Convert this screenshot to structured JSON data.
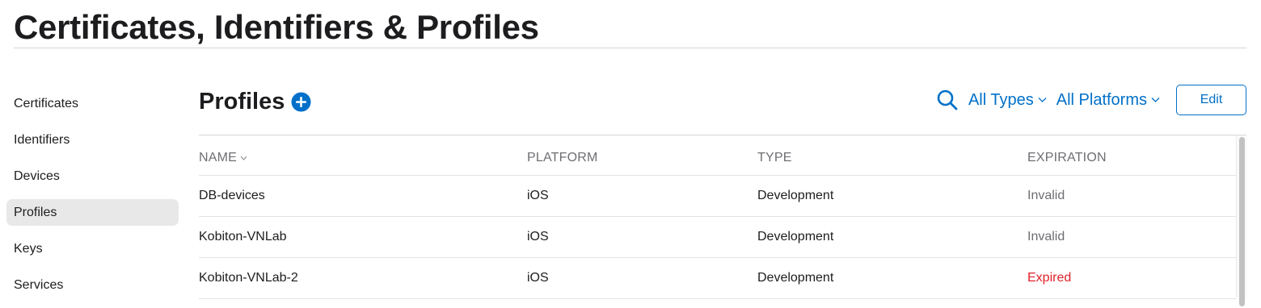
{
  "page_title": "Certificates, Identifiers & Profiles",
  "sidebar": {
    "items": [
      {
        "label": "Certificates"
      },
      {
        "label": "Identifiers"
      },
      {
        "label": "Devices"
      },
      {
        "label": "Profiles",
        "active": true
      },
      {
        "label": "Keys"
      },
      {
        "label": "Services"
      }
    ]
  },
  "section": {
    "title": "Profiles",
    "add_icon": "plus-circle-icon"
  },
  "toolbar": {
    "search_icon": "search-icon",
    "type_filter": "All Types",
    "platform_filter": "All Platforms",
    "edit_label": "Edit"
  },
  "table": {
    "headers": {
      "name": "NAME",
      "platform": "PLATFORM",
      "type": "TYPE",
      "expiration": "EXPIRATION"
    },
    "rows": [
      {
        "name": "DB-devices",
        "platform": "iOS",
        "type": "Development",
        "expiration": "Invalid"
      },
      {
        "name": "Kobiton-VNLab",
        "platform": "iOS",
        "type": "Development",
        "expiration": "Invalid"
      },
      {
        "name": "Kobiton-VNLab-2",
        "platform": "iOS",
        "type": "Development",
        "expiration": "Expired"
      }
    ]
  },
  "colors": {
    "accent": "#0070c9",
    "expired": "#e0212a",
    "muted": "#6e6e73",
    "active_sidebar_bg": "#e8e8e8"
  }
}
